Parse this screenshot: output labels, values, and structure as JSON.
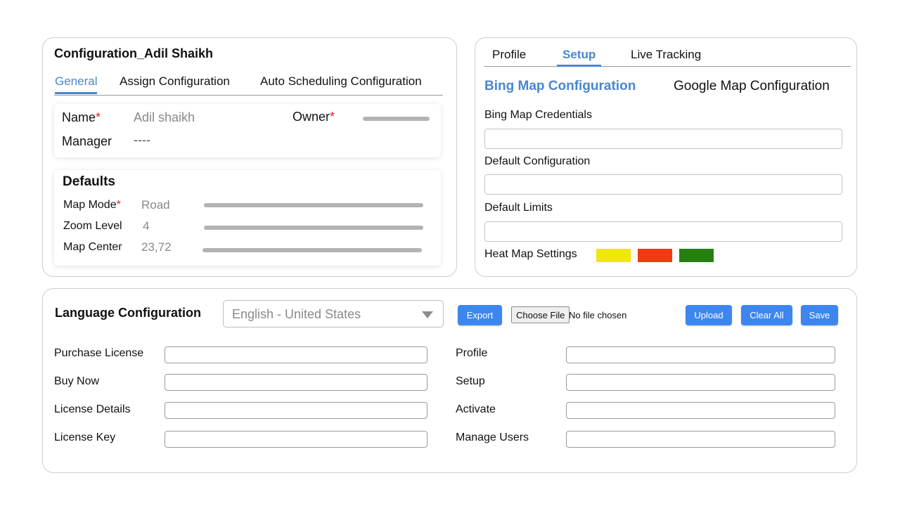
{
  "config": {
    "title": "Configuration_Adil Shaikh",
    "tabs": [
      {
        "label": "General",
        "active": true
      },
      {
        "label": "Assign Configuration",
        "active": false
      },
      {
        "label": "Auto Scheduling Configuration",
        "active": false
      }
    ],
    "general": {
      "name_label": "Name",
      "name_value": "Adil shaikh",
      "owner_label": "Owner",
      "manager_label": "Manager",
      "manager_value": "----",
      "required_mark": "*"
    },
    "defaults": {
      "title": "Defaults",
      "rows": [
        {
          "label": "Map Mode",
          "value": "Road",
          "required": true
        },
        {
          "label": "Zoom Level",
          "value": "4",
          "required": false
        },
        {
          "label": "Map Center",
          "value": "23,72",
          "required": false
        }
      ]
    }
  },
  "setup": {
    "tabs": [
      {
        "label": "Profile",
        "active": false
      },
      {
        "label": "Setup",
        "active": true
      },
      {
        "label": "Live Tracking",
        "active": false
      }
    ],
    "map_tabs": [
      {
        "label": "Bing Map Configuration",
        "active": true
      },
      {
        "label": "Google Map Configuration",
        "active": false
      }
    ],
    "fields": [
      {
        "label": "Bing Map Credentials",
        "value": ""
      },
      {
        "label": "Default Configuration",
        "value": ""
      },
      {
        "label": "Default Limits",
        "value": ""
      }
    ],
    "heatmap": {
      "label": "Heat Map Settings",
      "colors": [
        "#f2e70a",
        "#f03a12",
        "#26800f"
      ]
    }
  },
  "language": {
    "title": "Language Configuration",
    "selected": "English - United States",
    "buttons": {
      "export": "Export",
      "choose_file": "Choose File",
      "no_file": "No file chosen",
      "upload": "Upload",
      "clear_all": "Clear All",
      "save": "Save"
    },
    "left_fields": [
      {
        "label": "Purchase License",
        "value": ""
      },
      {
        "label": "Buy Now",
        "value": ""
      },
      {
        "label": "License Details",
        "value": ""
      },
      {
        "label": "License Key",
        "value": ""
      }
    ],
    "right_fields": [
      {
        "label": "Profile",
        "value": ""
      },
      {
        "label": "Setup",
        "value": ""
      },
      {
        "label": "Activate",
        "value": ""
      },
      {
        "label": "Manage Users",
        "value": ""
      }
    ]
  },
  "colors": {
    "accent": "#4a86cf",
    "button": "#3d86f0",
    "required": "#e0242c"
  }
}
